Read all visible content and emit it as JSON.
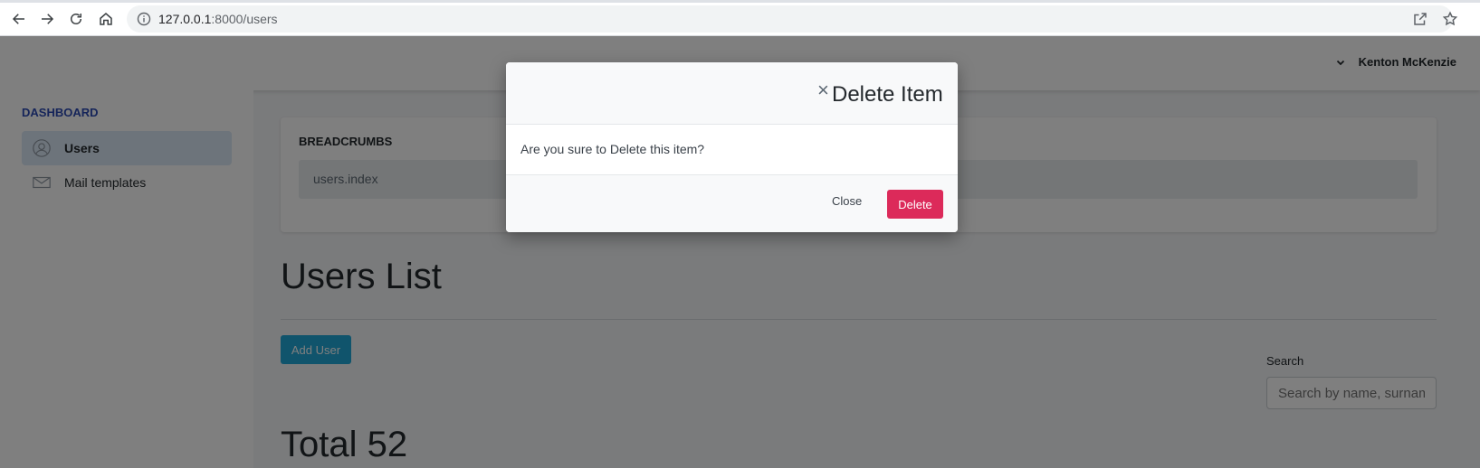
{
  "browser": {
    "url_host": "127.0.0.1",
    "url_path": ":8000/users"
  },
  "header": {
    "user_name": "Kenton McKenzie"
  },
  "sidebar": {
    "heading": "DASHBOARD",
    "items": [
      {
        "label": "Users",
        "icon": "user-circle-icon",
        "active": true
      },
      {
        "label": "Mail templates",
        "icon": "envelope-icon",
        "active": false
      }
    ]
  },
  "breadcrumbs": {
    "title": "BREADCRUMBS",
    "path": "users.index"
  },
  "main": {
    "title": "Users List",
    "add_button": "Add User",
    "search_label": "Search",
    "search_placeholder": "Search by name, surname",
    "total": "Total 52"
  },
  "modal": {
    "close_icon": "×",
    "title": "Delete Item",
    "message": "Are you sure to Delete this item?",
    "close_label": "Close",
    "delete_label": "Delete",
    "delete_color": "#dc2a5a"
  }
}
